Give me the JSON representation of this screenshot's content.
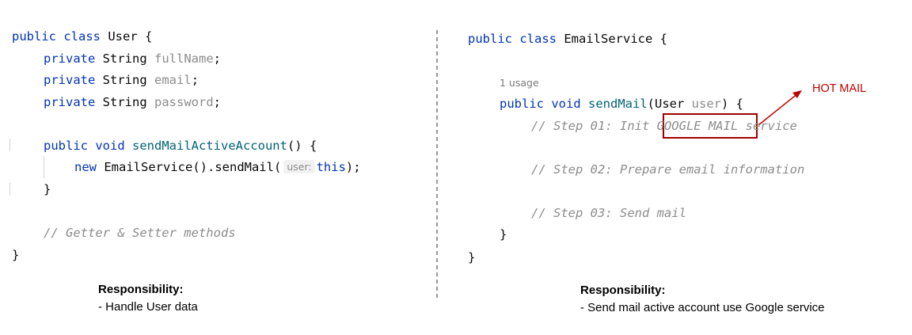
{
  "left_code": {
    "line1": {
      "kw": "public class",
      "name": "User",
      "brace": "{"
    },
    "fields": [
      {
        "kw": "private",
        "type": "String",
        "name": "fullName",
        "end": ";"
      },
      {
        "kw": "private",
        "type": "String",
        "name": "email",
        "end": ";"
      },
      {
        "kw": "private",
        "type": "String",
        "name": "password",
        "end": ";"
      }
    ],
    "method_sig": {
      "kw": "public void",
      "name": "sendMailActiveAccount",
      "rest": "() {"
    },
    "method_body": {
      "kw": "new",
      "call": "EmailService().sendMail(",
      "hint": "user:",
      "arg": "this",
      "end": ");"
    },
    "method_close": "}",
    "comment": "// Getter & Setter methods",
    "class_close": "}"
  },
  "right_code": {
    "line1": {
      "kw": "public class",
      "name": "EmailService",
      "brace": "{"
    },
    "usage": "1 usage",
    "method_sig": {
      "kw": "public void",
      "name": "sendMail",
      "open": "(User",
      "param": "user",
      "close": ") {"
    },
    "step1": {
      "pre": "// Step 01: Init ",
      "highlight": "GOOGLE MAIL",
      "post": " service"
    },
    "step2": "// Step 02: Prepare email information",
    "step3": "// Step 03: Send mail",
    "method_close": "}",
    "class_close": "}"
  },
  "annotation": {
    "label": "HOT MAIL",
    "color": "#c00000"
  },
  "left_responsibility": {
    "title": "Responsibility:",
    "item": "- Handle User data"
  },
  "right_responsibility": {
    "title": "Responsibility:",
    "item": "- Send mail active account use Google service"
  },
  "colors": {
    "keyword": "#0033b3",
    "field": "#871094",
    "method": "#00627a",
    "comment": "#8c8c8c",
    "highlight_box": "#a00000"
  }
}
